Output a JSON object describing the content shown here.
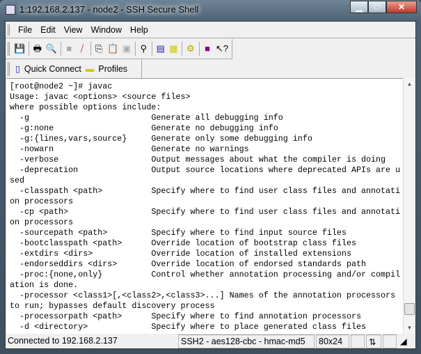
{
  "window": {
    "title": "1:192.168.2.137 - node2 - SSH Secure Shell"
  },
  "menu": [
    "File",
    "Edit",
    "View",
    "Window",
    "Help"
  ],
  "toolbar_icons": [
    "save-icon",
    "print-icon",
    "print-preview-icon",
    "disabled-icon",
    "disconnect-icon",
    "copy-icon",
    "paste-icon",
    "paste-disabled-icon",
    "find-icon",
    "new-terminal-icon",
    "new-file-transfer-icon",
    "settings-icon",
    "help-book-icon",
    "context-help-icon"
  ],
  "quickbar": {
    "quick_connect": "Quick Connect",
    "profiles": "Profiles"
  },
  "terminal": {
    "lines": [
      "[root@node2 ~]# javac",
      "Usage: javac <options> <source files>",
      "where possible options include:",
      "  -g                         Generate all debugging info",
      "  -g:none                    Generate no debugging info",
      "  -g:{lines,vars,source}     Generate only some debugging info",
      "  -nowarn                    Generate no warnings",
      "  -verbose                   Output messages about what the compiler is doing",
      "  -deprecation               Output source locations where deprecated APIs are u",
      "sed",
      "  -classpath <path>          Specify where to find user class files and annotati",
      "on processors",
      "  -cp <path>                 Specify where to find user class files and annotati",
      "on processors",
      "  -sourcepath <path>         Specify where to find input source files",
      "  -bootclasspath <path>      Override location of bootstrap class files",
      "  -extdirs <dirs>            Override location of installed extensions",
      "  -endorseddirs <dirs>       Override location of endorsed standards path",
      "  -proc:{none,only}          Control whether annotation processing and/or compil",
      "ation is done.",
      "  -processor <class1>[,<class2>,<class3>...] Names of the annotation processors",
      "to run; bypasses default discovery process",
      "  -processorpath <path>      Specify where to find annotation processors",
      "  -d <directory>             Specify where to place generated class files"
    ]
  },
  "status": {
    "connection": "Connected to 192.168.2.137",
    "cipher": "SSH2 - aes128-cbc - hmac-md5",
    "size": "80x24"
  }
}
